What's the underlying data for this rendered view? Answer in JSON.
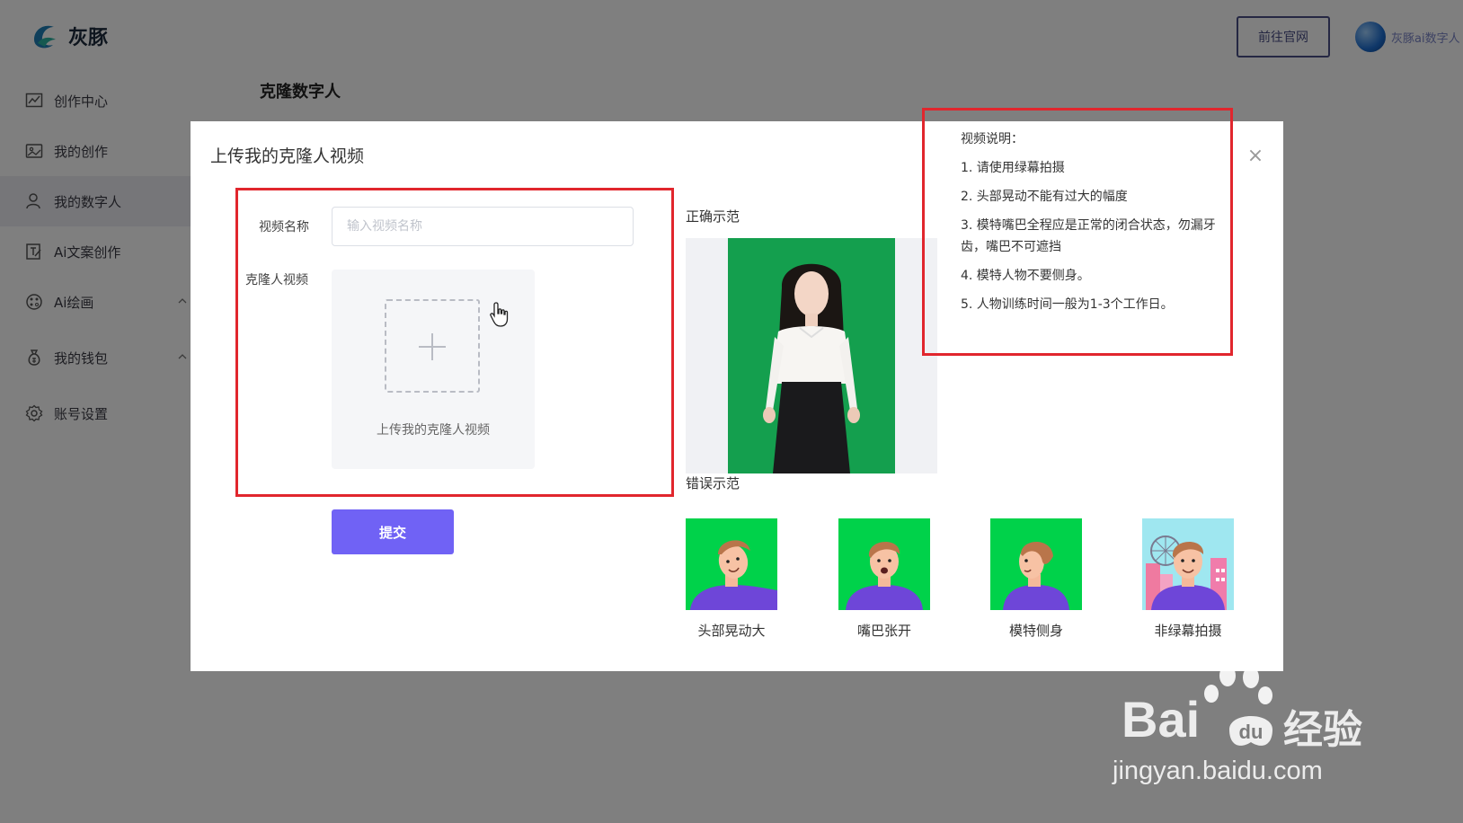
{
  "app": {
    "brand": "灰豚"
  },
  "header": {
    "site_button": "前往官网",
    "user_name": "灰豚ai数字人"
  },
  "sidebar": {
    "items": [
      {
        "label": "创作中心",
        "icon": "chart-icon"
      },
      {
        "label": "我的创作",
        "icon": "image-icon"
      },
      {
        "label": "我的数字人",
        "icon": "person-icon",
        "active": true
      },
      {
        "label": "Ai文案创作",
        "icon": "edit-doc-icon"
      },
      {
        "label": "Ai绘画",
        "icon": "palette-icon",
        "expandable": true
      },
      {
        "label": "我的钱包",
        "icon": "money-bag-icon",
        "expandable": true
      },
      {
        "label": "账号设置",
        "icon": "gear-icon"
      }
    ]
  },
  "page": {
    "title": "克隆数字人"
  },
  "modal": {
    "title": "上传我的克隆人视频",
    "close": "×",
    "form": {
      "name_label": "视频名称",
      "name_placeholder": "输入视频名称",
      "name_value": "",
      "video_label": "克隆人视频",
      "upload_text": "上传我的克隆人视频",
      "submit": "提交"
    },
    "correct_label": "正确示范",
    "wrong_label": "错误示范",
    "notes": {
      "title": "视频说明：",
      "items": [
        "1. 请使用绿幕拍摄",
        "2. 头部晃动不能有过大的幅度",
        "3. 模特嘴巴全程应是正常的闭合状态，勿漏牙齿，嘴巴不可遮挡",
        "4. 模特人物不要侧身。",
        "5. 人物训练时间一般为1-3个工作日。"
      ]
    },
    "wrong_examples": [
      {
        "caption": "头部晃动大"
      },
      {
        "caption": "嘴巴张开"
      },
      {
        "caption": "模特侧身"
      },
      {
        "caption": "非绿幕拍摄"
      }
    ]
  },
  "watermark": {
    "brand_text": "Bai",
    "brand_cn": "经验",
    "url": "jingyan.baidu.com"
  },
  "colors": {
    "accent": "#7062f5",
    "highlight": "#e1262d",
    "green_screen": "#00d24a"
  }
}
